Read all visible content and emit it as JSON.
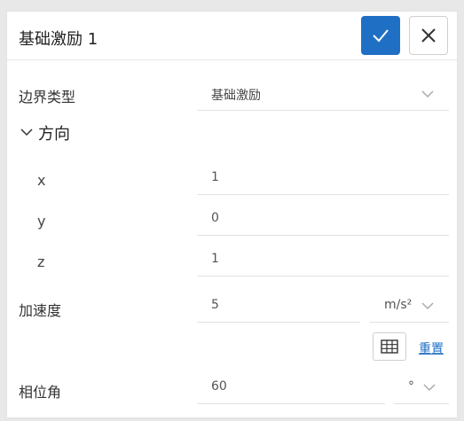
{
  "header": {
    "title": "基础激励 1"
  },
  "boundary_type": {
    "label": "边界类型",
    "value": "基础激励"
  },
  "direction": {
    "label": "方向",
    "x": {
      "label": "x",
      "value": "1"
    },
    "y": {
      "label": "y",
      "value": "0"
    },
    "z": {
      "label": "z",
      "value": "1"
    }
  },
  "acceleration": {
    "label": "加速度",
    "value": "5",
    "unit": "m/s²"
  },
  "table": {
    "reset_label": "重置"
  },
  "phase": {
    "label": "相位角",
    "value": "60",
    "unit": "°"
  },
  "colors": {
    "accent": "#1f6fc5"
  }
}
